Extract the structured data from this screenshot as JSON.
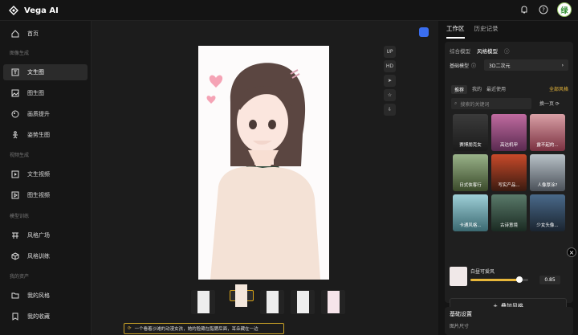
{
  "app": {
    "name": "Vega AI"
  },
  "header": {
    "avatar_text": "绿"
  },
  "sidebar": {
    "home": "首页",
    "sec_image": "图像生成",
    "txt2img": "文生图",
    "img2img": "图生图",
    "upscale": "画质提升",
    "pose": "姿势生图",
    "sec_video": "视频生成",
    "txt2video": "文生视频",
    "img2video": "图生视频",
    "sec_train": "模型训练",
    "style_square": "风格广场",
    "style_train": "风格训练",
    "sec_assets": "我的资产",
    "my_styles": "我的风格",
    "my_favorites": "我的收藏"
  },
  "canvas": {
    "tools": [
      "UP",
      "HD"
    ],
    "prompt": "一个看着沙滩的动漫女孩，她的脸藏在脂腮后面，耳朵藏在一边"
  },
  "right": {
    "tab_work": "工作区",
    "tab_history": "历史记录",
    "sub_general": "综合模型",
    "sub_style": "风格模型",
    "base_label": "基础模型",
    "base_value": "3D二次元",
    "filter_recommend": "推荐",
    "filter_mine": "我的",
    "filter_recent": "最近使用",
    "filter_all": "全部风格",
    "search_placeholder": "搜索的关键词",
    "swap": "换一页",
    "cards": [
      "赛博朋克女",
      "高达机甲",
      "露不起的...",
      "日式侠客行",
      "写实产品...",
      "人像厚涂?",
      "卡通风格...",
      "古诗意境",
      "少女头像..."
    ],
    "current_style": "白昼可爱风",
    "weight": "0.85",
    "weight_fraction": 0.85,
    "add_style": "叠加风格",
    "basic_title": "基础设置",
    "size_label": "图片尺寸"
  },
  "colors": {
    "accent": "#e8b73a",
    "pin": "#3a6ef0"
  }
}
